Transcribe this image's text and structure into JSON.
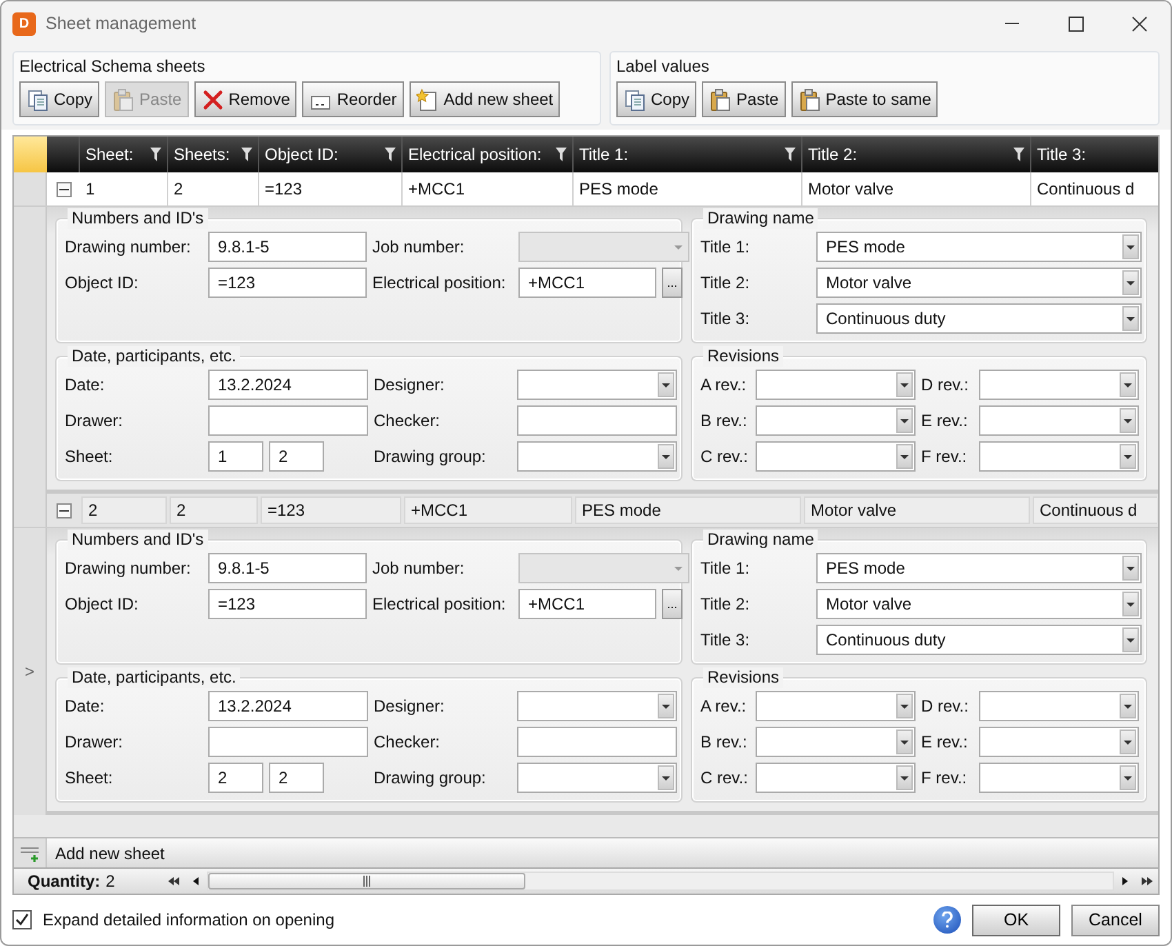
{
  "window": {
    "title": "Sheet management",
    "app_letter": "D"
  },
  "toolbar_groups": [
    {
      "title": "Electrical Schema sheets",
      "buttons": [
        {
          "label": "Copy",
          "kind": "copy",
          "disabled": false
        },
        {
          "label": "Paste",
          "kind": "paste",
          "disabled": true
        },
        {
          "label": "Remove",
          "kind": "remove",
          "disabled": false
        },
        {
          "label": "Reorder",
          "kind": "reorder",
          "disabled": false
        },
        {
          "label": "Add new sheet",
          "kind": "add",
          "disabled": false
        }
      ]
    },
    {
      "title": "Label values",
      "buttons": [
        {
          "label": "Copy",
          "kind": "copy",
          "disabled": false
        },
        {
          "label": "Paste",
          "kind": "paste",
          "disabled": false
        },
        {
          "label": "Paste to same",
          "kind": "paste",
          "disabled": false
        }
      ]
    }
  ],
  "grid": {
    "columns": [
      {
        "label": "Sheet:",
        "filter_icon": true
      },
      {
        "label": "Sheets:",
        "filter_icon": true
      },
      {
        "label": "Object ID:",
        "filter_icon": true
      },
      {
        "label": "Electrical position:",
        "filter_icon": true
      },
      {
        "label": "Title 1:",
        "filter_icon": true
      },
      {
        "label": "Title 2:",
        "filter_icon": true
      },
      {
        "label": "Title 3:",
        "filter_icon": false
      }
    ],
    "rows": [
      {
        "current": false,
        "expanded": true,
        "cells": [
          "1",
          "2",
          "=123",
          "+MCC1",
          "PES mode",
          "Motor valve",
          "Continuous d"
        ],
        "details": [
          {
            "title": "Numbers and ID's",
            "fields": [
              {
                "label": "Drawing number:",
                "kind": "text",
                "value": "9.8.1-5"
              },
              {
                "label": "Job number:",
                "kind": "combo",
                "disabled": true
              },
              {
                "label": "Object ID:",
                "kind": "text",
                "value": "=123"
              },
              {
                "label": "Electrical position:",
                "kind": "browse",
                "value": "+MCC1",
                "button_label": "..."
              }
            ]
          },
          {
            "title": "Drawing name",
            "fields": [
              {
                "label": "Title 1:",
                "kind": "combo",
                "value": "PES mode",
                "disabled": false
              },
              {
                "label": "Title 2:",
                "kind": "combo",
                "value": "Motor valve",
                "disabled": false
              },
              {
                "label": "Title 3:",
                "kind": "combo",
                "value": "Continuous duty",
                "disabled": false
              }
            ]
          },
          {
            "title": "Date, participants, etc.",
            "fields": [
              {
                "label": "Date:",
                "kind": "text",
                "value": "13.2.2024"
              },
              {
                "label": "Designer:",
                "kind": "combo",
                "disabled": false
              },
              {
                "label": "Drawer:",
                "kind": "text"
              },
              {
                "label": "Checker:",
                "kind": "text"
              },
              {
                "label": "Sheet:",
                "kind": "pair",
                "values": [
                  "1",
                  "2"
                ]
              },
              {
                "label": "Drawing group:",
                "kind": "combo",
                "disabled": false
              }
            ]
          },
          {
            "title": "Revisions",
            "fields": [
              {
                "label": "A rev.:",
                "kind": "combo",
                "disabled": false
              },
              {
                "label": "D rev.:",
                "kind": "combo",
                "disabled": false
              },
              {
                "label": "B rev.:",
                "kind": "combo",
                "disabled": false
              },
              {
                "label": "E rev.:",
                "kind": "combo",
                "disabled": false
              },
              {
                "label": "C rev.:",
                "kind": "combo",
                "disabled": false
              },
              {
                "label": "F rev.:",
                "kind": "combo",
                "disabled": false
              }
            ]
          }
        ]
      },
      {
        "current": true,
        "marker": ">",
        "expanded": true,
        "cells": [
          "2",
          "2",
          "=123",
          "+MCC1",
          "PES mode",
          "Motor valve",
          "Continuous d"
        ],
        "details": [
          {
            "title": "Numbers and ID's",
            "fields": [
              {
                "label": "Drawing number:",
                "kind": "text",
                "value": "9.8.1-5"
              },
              {
                "label": "Job number:",
                "kind": "combo",
                "disabled": true
              },
              {
                "label": "Object ID:",
                "kind": "text",
                "value": "=123"
              },
              {
                "label": "Electrical position:",
                "kind": "browse",
                "value": "+MCC1",
                "button_label": "..."
              }
            ]
          },
          {
            "title": "Drawing name",
            "fields": [
              {
                "label": "Title 1:",
                "kind": "combo",
                "value": "PES mode",
                "disabled": false
              },
              {
                "label": "Title 2:",
                "kind": "combo",
                "value": "Motor valve",
                "disabled": false
              },
              {
                "label": "Title 3:",
                "kind": "combo",
                "value": "Continuous duty",
                "disabled": false
              }
            ]
          },
          {
            "title": "Date, participants, etc.",
            "fields": [
              {
                "label": "Date:",
                "kind": "text",
                "value": "13.2.2024"
              },
              {
                "label": "Designer:",
                "kind": "combo",
                "disabled": false
              },
              {
                "label": "Drawer:",
                "kind": "text"
              },
              {
                "label": "Checker:",
                "kind": "text"
              },
              {
                "label": "Sheet:",
                "kind": "pair",
                "values": [
                  "2",
                  "2"
                ]
              },
              {
                "label": "Drawing group:",
                "kind": "combo",
                "disabled": false
              }
            ]
          },
          {
            "title": "Revisions",
            "fields": [
              {
                "label": "A rev.:",
                "kind": "combo",
                "disabled": false
              },
              {
                "label": "D rev.:",
                "kind": "combo",
                "disabled": false
              },
              {
                "label": "B rev.:",
                "kind": "combo",
                "disabled": false
              },
              {
                "label": "E rev.:",
                "kind": "combo",
                "disabled": false
              },
              {
                "label": "C rev.:",
                "kind": "combo",
                "disabled": false
              },
              {
                "label": "F rev.:",
                "kind": "combo",
                "disabled": false
              }
            ]
          }
        ]
      }
    ],
    "add_row_label": "Add new sheet",
    "quantity_label": "Quantity:",
    "quantity": "2"
  },
  "footer": {
    "checkbox": {
      "label": "Expand detailed information on opening",
      "checked": true
    },
    "buttons": [
      {
        "label": "OK",
        "default": true
      },
      {
        "label": "Cancel",
        "default": false
      }
    ]
  }
}
